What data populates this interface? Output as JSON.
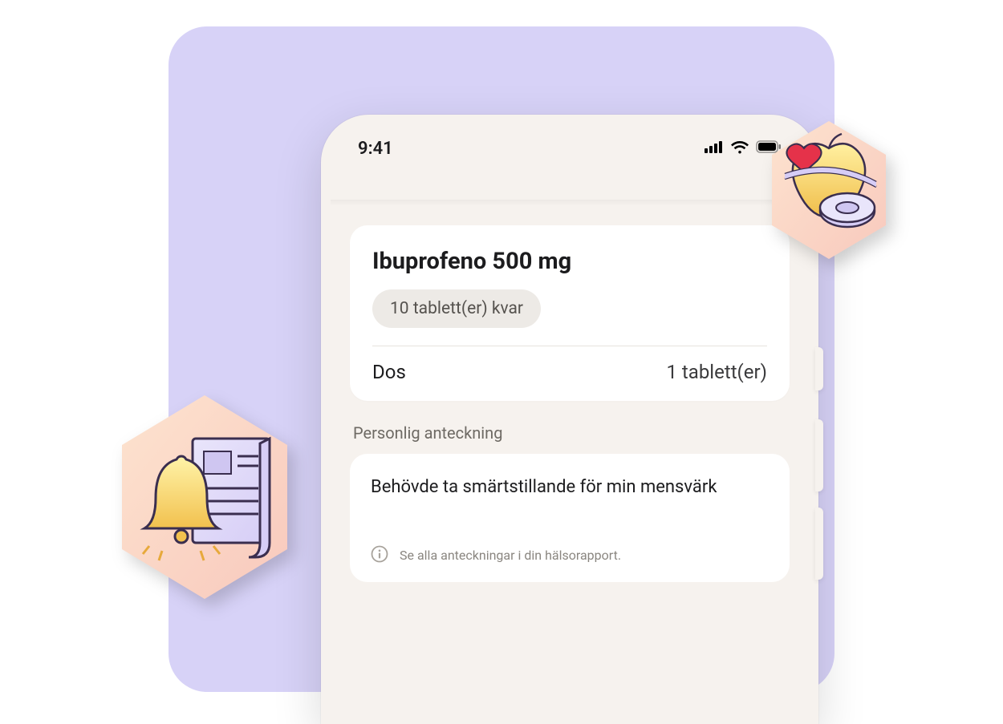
{
  "status": {
    "time": "9:41"
  },
  "medication": {
    "name": "Ibuprofeno 500 mg",
    "remaining": "10 tablett(er) kvar",
    "dose_label": "Dos",
    "dose_value": "1 tablett(er)"
  },
  "note": {
    "section_label": "Personlig anteckning",
    "text": "Behövde ta smärtstillande för min mensvärk",
    "footer": "Se alla anteckningar i din hälsorapport."
  }
}
